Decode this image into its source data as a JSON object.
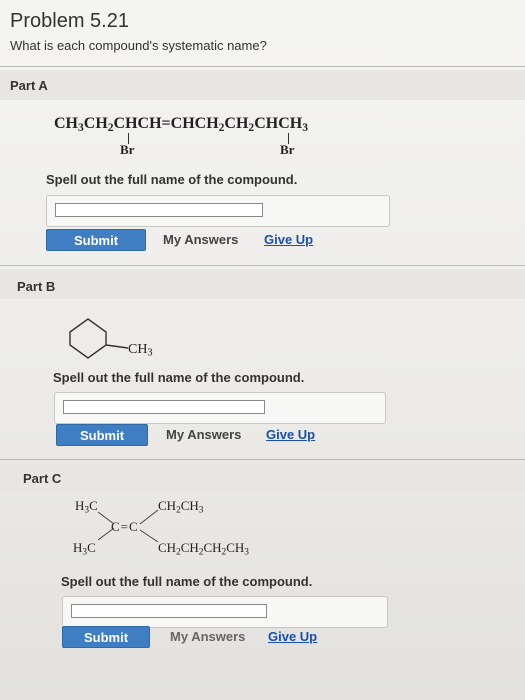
{
  "header": {
    "title": "Problem 5.21",
    "question": "What is each compound's systematic name?"
  },
  "parts": [
    {
      "label": "Part A",
      "formula": {
        "segments": [
          "CH",
          "3",
          "CH",
          "2",
          "CHCH=CHCH",
          "2",
          "CH",
          "2",
          "CHCH",
          "3"
        ],
        "substituents": [
          "Br",
          "Br"
        ]
      },
      "prompt": "Spell out the full name of the compound.",
      "answer_value": "",
      "submit_label": "Submit",
      "my_answers_label": "My Answers",
      "give_up_label": "Give Up"
    },
    {
      "label": "Part B",
      "formula": {
        "substituent": "CH",
        "substituent_sub": "3"
      },
      "prompt": "Spell out the full name of the compound.",
      "answer_value": "",
      "submit_label": "Submit",
      "my_answers_label": "My Answers",
      "give_up_label": "Give Up"
    },
    {
      "label": "Part C",
      "formula": {
        "top_left": [
          "H",
          "3",
          "C"
        ],
        "bottom_left": [
          "H",
          "3",
          "C"
        ],
        "top_right": [
          "CH",
          "2",
          "CH",
          "3"
        ],
        "bottom_right": [
          "CH",
          "2",
          "CH",
          "2",
          "CH",
          "2",
          "CH",
          "3"
        ],
        "center": "C=C"
      },
      "prompt": "Spell out the full name of the compound.",
      "answer_value": "",
      "submit_label": "Submit",
      "my_answers_label": "My Answers",
      "give_up_label": "Give Up"
    }
  ]
}
